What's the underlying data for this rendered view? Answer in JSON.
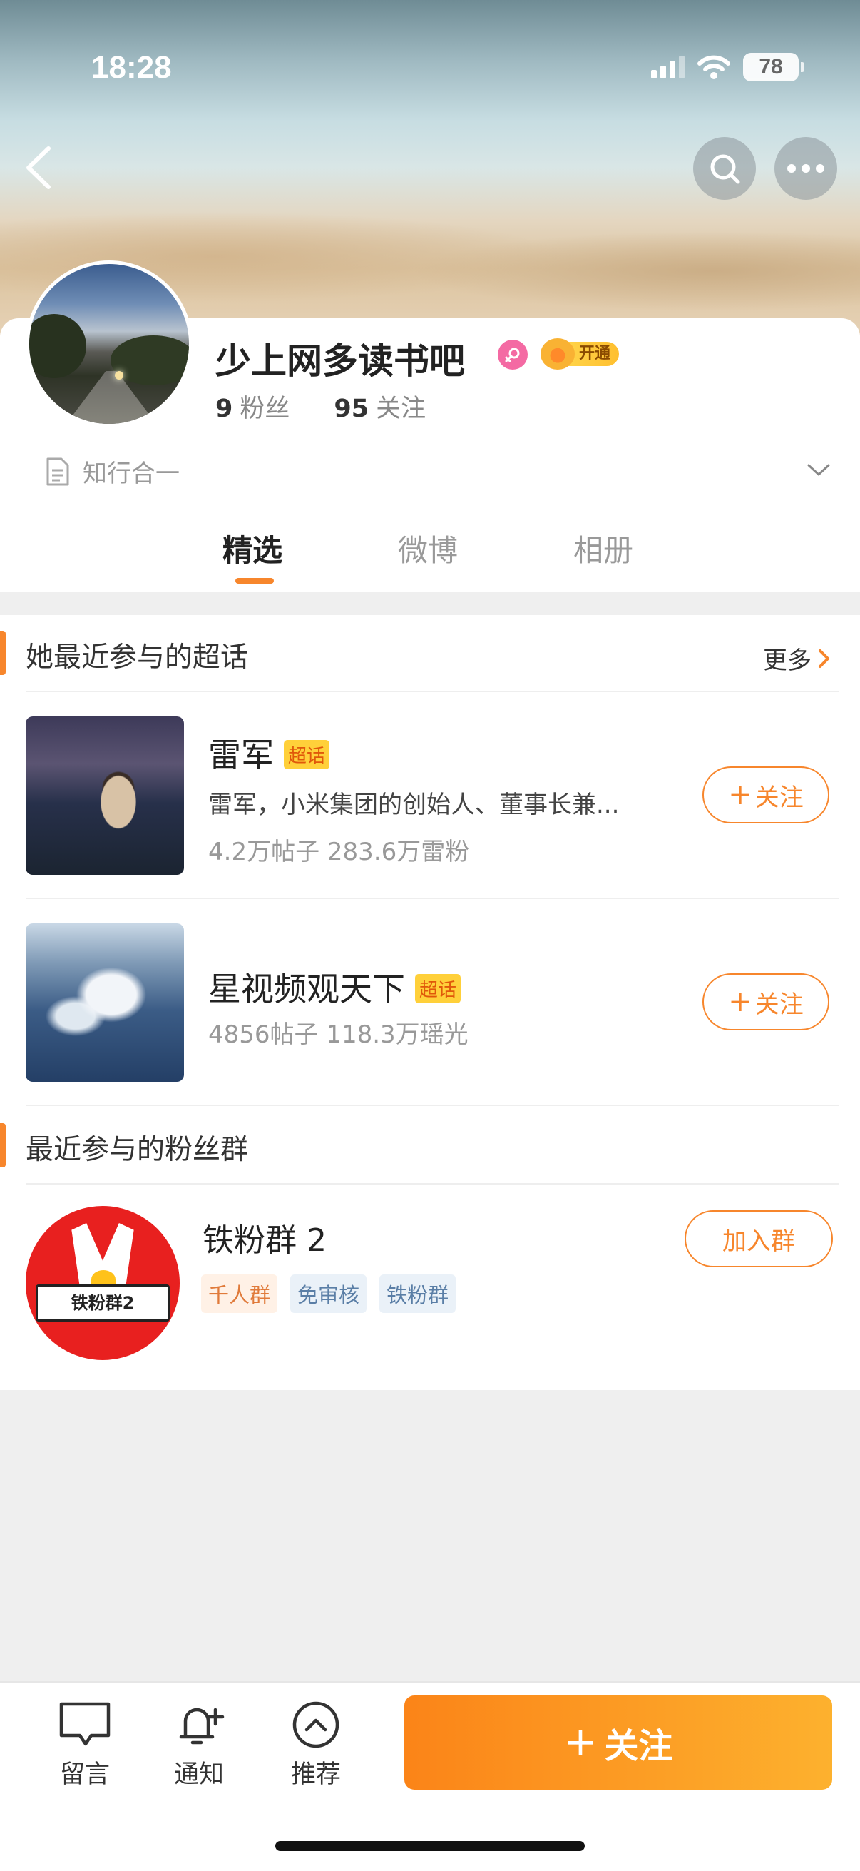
{
  "status_bar": {
    "time": "18:28",
    "battery": "78"
  },
  "profile": {
    "nickname": "少上网多读书吧",
    "vip_label": "开通",
    "fans_count": "9",
    "fans_label": "粉丝",
    "following_count": "95",
    "following_label": "关注",
    "bio": "知行合一"
  },
  "tabs": [
    {
      "label": "精选",
      "active": true
    },
    {
      "label": "微博",
      "active": false
    },
    {
      "label": "相册",
      "active": false
    }
  ],
  "super_topics": {
    "title": "她最近参与的超话",
    "more_label": "更多",
    "items": [
      {
        "name": "雷军",
        "tag": "超话",
        "desc": "雷军，小米集团的创始人、董事长兼...",
        "meta": "4.2万帖子 283.6万雷粉",
        "follow_label": "关注"
      },
      {
        "name": "星视频观天下",
        "tag": "超话",
        "meta": "4856帖子 118.3万瑶光",
        "follow_label": "关注"
      }
    ]
  },
  "fan_groups": {
    "title": "最近参与的粉丝群",
    "items": [
      {
        "name": "铁粉群 2",
        "avatar_text": "铁粉群2",
        "tags": [
          "千人群",
          "免审核",
          "铁粉群"
        ],
        "join_label": "加入群"
      }
    ]
  },
  "bottom_bar": {
    "message_label": "留言",
    "notify_label": "通知",
    "recommend_label": "推荐",
    "follow_label": "关注"
  },
  "colors": {
    "accent": "#f7862c",
    "vip": "#ffc42e",
    "female": "#f46aa3"
  }
}
